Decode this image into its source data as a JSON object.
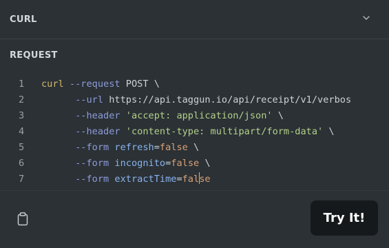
{
  "curl_section": {
    "title": "CURL",
    "toggle_icon": "chevron-down-icon"
  },
  "request_section": {
    "title": "REQUEST"
  },
  "code": {
    "lines": [
      {
        "number": "1",
        "tokens": [
          {
            "text": "curl",
            "kind": "cmd"
          },
          {
            "text": " ",
            "kind": "plain"
          },
          {
            "text": "--request",
            "kind": "flag"
          },
          {
            "text": " POST \\",
            "kind": "plain"
          }
        ]
      },
      {
        "number": "2",
        "tokens": [
          {
            "text": "      ",
            "kind": "plain"
          },
          {
            "text": "--url",
            "kind": "flag"
          },
          {
            "text": " https://api.taggun.io/api/receipt/v1/verbos",
            "kind": "plain"
          }
        ]
      },
      {
        "number": "3",
        "tokens": [
          {
            "text": "      ",
            "kind": "plain"
          },
          {
            "text": "--header",
            "kind": "flag"
          },
          {
            "text": " ",
            "kind": "plain"
          },
          {
            "text": "'accept: application/json'",
            "kind": "str"
          },
          {
            "text": " \\",
            "kind": "plain"
          }
        ]
      },
      {
        "number": "4",
        "tokens": [
          {
            "text": "      ",
            "kind": "plain"
          },
          {
            "text": "--header",
            "kind": "flag"
          },
          {
            "text": " ",
            "kind": "plain"
          },
          {
            "text": "'content-type: multipart/form-data'",
            "kind": "str"
          },
          {
            "text": " \\",
            "kind": "plain"
          }
        ]
      },
      {
        "number": "5",
        "tokens": [
          {
            "text": "      ",
            "kind": "plain"
          },
          {
            "text": "--form",
            "kind": "flag"
          },
          {
            "text": " ",
            "kind": "plain"
          },
          {
            "text": "refresh",
            "kind": "key"
          },
          {
            "text": "=",
            "kind": "plain"
          },
          {
            "text": "false",
            "kind": "val"
          },
          {
            "text": " \\",
            "kind": "plain"
          }
        ]
      },
      {
        "number": "6",
        "tokens": [
          {
            "text": "      ",
            "kind": "plain"
          },
          {
            "text": "--form",
            "kind": "flag"
          },
          {
            "text": " ",
            "kind": "plain"
          },
          {
            "text": "incognito",
            "kind": "key"
          },
          {
            "text": "=",
            "kind": "plain"
          },
          {
            "text": "false",
            "kind": "val"
          },
          {
            "text": " \\",
            "kind": "plain"
          }
        ]
      },
      {
        "number": "7",
        "tokens": [
          {
            "text": "      ",
            "kind": "plain"
          },
          {
            "text": "--form",
            "kind": "flag"
          },
          {
            "text": " ",
            "kind": "plain"
          },
          {
            "text": "extractTime",
            "kind": "key"
          },
          {
            "text": "=",
            "kind": "plain"
          },
          {
            "text": "fal",
            "kind": "val"
          },
          {
            "text": "",
            "kind": "cursor"
          },
          {
            "text": "se",
            "kind": "val"
          }
        ]
      }
    ]
  },
  "footer": {
    "copy_icon": "clipboard-icon",
    "try_button_label": "Try It!"
  }
}
